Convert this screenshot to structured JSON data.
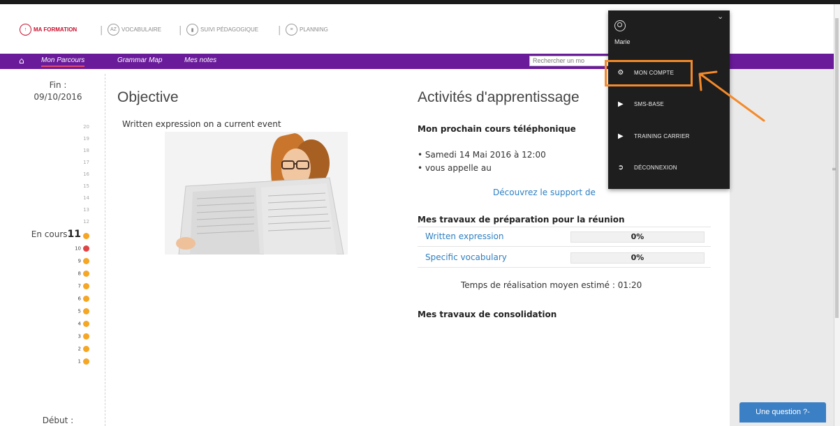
{
  "top_modules": [
    {
      "label": "MA FORMATION",
      "icon": "arrow-up-circle-icon",
      "glyph": "↑",
      "active": true
    },
    {
      "label": "VOCABULAIRE",
      "icon": "az-circle-icon",
      "glyph": "AZ",
      "active": false
    },
    {
      "label": "SUIVI PÉDAGOGIQUE",
      "icon": "chart-circle-icon",
      "glyph": "▮",
      "active": false
    },
    {
      "label": "PLANNING",
      "icon": "planning-circle-icon",
      "glyph": "≡",
      "active": false
    }
  ],
  "subnav": {
    "links": [
      "Mon Parcours",
      "Grammar Map",
      "Mes notes"
    ],
    "search_placeholder": "Rechercher un mo"
  },
  "left": {
    "fin_label": "Fin :",
    "fin_date": "09/10/2016",
    "ladder": [
      "20",
      "19",
      "18",
      "17",
      "16",
      "15",
      "14",
      "13",
      "12",
      "11",
      "10",
      "9",
      "8",
      "7",
      "6",
      "5",
      "4",
      "3",
      "2",
      "1"
    ],
    "current_label": "En cours",
    "current_level": "11",
    "debut_label": "Début :"
  },
  "objective": {
    "title": "Objective",
    "text": "Written expression on a current event"
  },
  "activities": {
    "title": "Activités d'apprentissage",
    "next_call_heading": "Mon prochain cours téléphonique",
    "call_date": "• Samedi 14 Mai 2016 à 12:00",
    "call_note": "• vous appelle au",
    "discover_link": "Découvrez le support de",
    "prep_heading": "Mes travaux de préparation pour la réunion",
    "tasks": [
      {
        "name": "Written expression",
        "progress": "0%"
      },
      {
        "name": "Specific vocabulary",
        "progress": "0%"
      }
    ],
    "estimated_time": "Temps de réalisation moyen estimé : 01:20",
    "consolidation_heading": "Mes travaux de consolidation"
  },
  "account_menu": {
    "username": "Marie",
    "items": [
      {
        "label": "MON COMPTE",
        "icon": "gear-icon"
      },
      {
        "label": "SMS-BASE",
        "icon": "play-icon"
      },
      {
        "label": "TRAINING CARRIER",
        "icon": "play-icon"
      },
      {
        "label": "DÉCONNEXION",
        "icon": "logout-icon"
      }
    ]
  },
  "help_button": "Une question ?-",
  "colors": {
    "brand_purple": "#6a1b9a",
    "brand_red": "#c8102e",
    "level_orange": "#f5a623",
    "level_red": "#e04545",
    "highlight_orange": "#f48a2a",
    "link_blue": "#2d7fc1"
  }
}
